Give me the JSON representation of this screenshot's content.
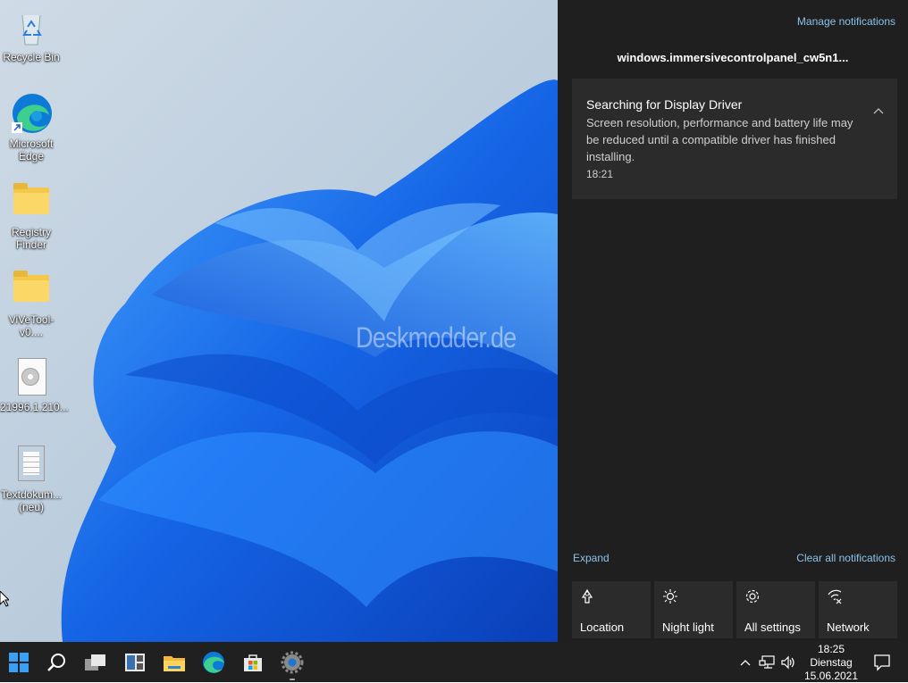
{
  "desktop": {
    "watermark": "Deskmodder.de",
    "icons": [
      {
        "label": "Recycle Bin",
        "icon": "recycle-bin-icon"
      },
      {
        "label": "Microsoft Edge",
        "icon": "edge-shortcut-icon"
      },
      {
        "label": "Registry Finder",
        "icon": "folder-icon"
      },
      {
        "label": "ViVeTool-v0....",
        "icon": "folder-icon"
      },
      {
        "label": "21996.1.210...",
        "icon": "disc-image-icon"
      },
      {
        "label": "Textdokum... (neu)",
        "icon": "text-document-icon"
      }
    ]
  },
  "action_center": {
    "manage_notifications": "Manage notifications",
    "app_name": "windows.immersivecontrolpanel_cw5n1...",
    "notification": {
      "title": "Searching for Display Driver",
      "body": "Screen resolution, performance and battery life may be reduced until a compatible driver has finished installing.",
      "time": "18:21"
    },
    "expand": "Expand",
    "clear_all": "Clear all notifications",
    "quick_actions": [
      {
        "label": "Location",
        "icon": "location-icon"
      },
      {
        "label": "Night light",
        "icon": "night-light-icon"
      },
      {
        "label": "All settings",
        "icon": "gear-icon"
      },
      {
        "label": "Network",
        "icon": "network-icon"
      }
    ]
  },
  "taskbar": {
    "apps": [
      "start-icon",
      "search-icon",
      "task-view-icon",
      "widgets-icon",
      "file-explorer-icon",
      "edge-icon",
      "store-icon",
      "settings-icon"
    ],
    "clock": {
      "time": "18:25",
      "day": "Dienstag",
      "date": "15.06.2021"
    }
  },
  "colors": {
    "accent_link": "#8ac3ea",
    "panel_bg": "#1f1f1f",
    "tile_bg": "#2b2b2b",
    "taskbar_bg": "#202020"
  }
}
